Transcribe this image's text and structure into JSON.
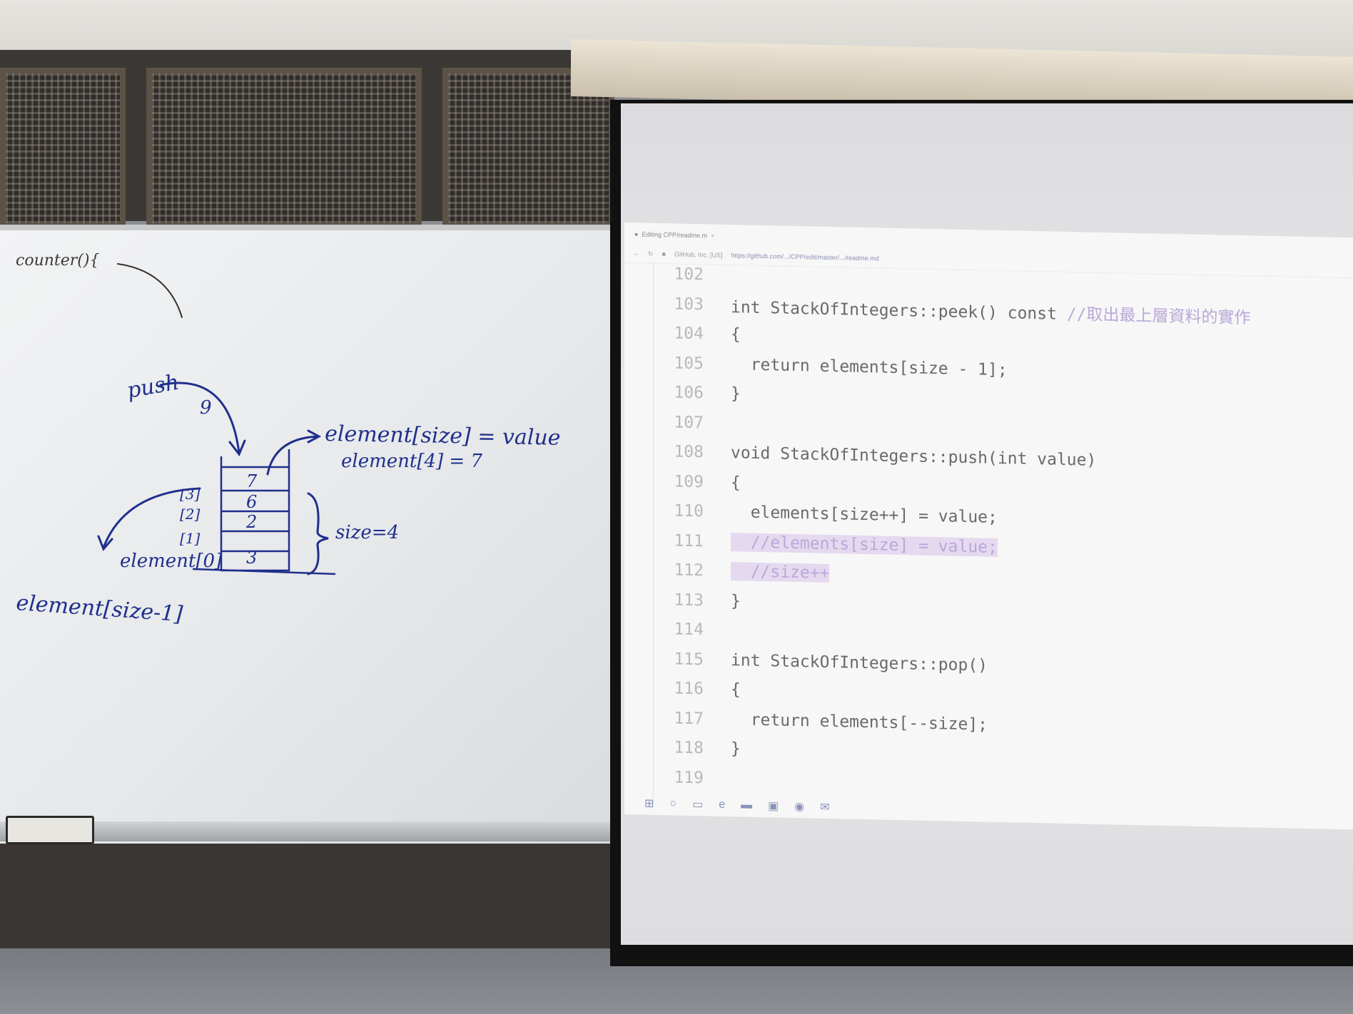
{
  "whiteboard": {
    "notes": {
      "counter": "counter(){",
      "push": "push",
      "pushed_value": "9",
      "assign_generic": "element[size] = value",
      "assign_example": "element[4] = 7",
      "size_note": "size=4",
      "top_formula": "element[size-1]",
      "base_label": "element[0]"
    },
    "stack": {
      "indices": [
        "[3]",
        "[2]",
        "[1]"
      ],
      "values": [
        "7",
        "6",
        "2",
        "3"
      ]
    }
  },
  "screen": {
    "tab_title": "Editing CPP/readme.m",
    "tab_close": "×",
    "address_prefix": "GitHub, Inc. [US]",
    "url": "https://github.com/.../CPP/edit/master/.../readme.md",
    "code_lines": [
      {
        "number": "102",
        "text": ""
      },
      {
        "number": "103",
        "text": "int StackOfIntegers::peek() const //取出最上層資料的實作"
      },
      {
        "number": "104",
        "text": "{"
      },
      {
        "number": "105",
        "text": "  return elements[size - 1];"
      },
      {
        "number": "106",
        "text": "}"
      },
      {
        "number": "107",
        "text": ""
      },
      {
        "number": "108",
        "text": "void StackOfIntegers::push(int value)"
      },
      {
        "number": "109",
        "text": "{"
      },
      {
        "number": "110",
        "text": "  elements[size++] = value;"
      },
      {
        "number": "111",
        "text": "  //elements[size] = value;",
        "highlighted": true
      },
      {
        "number": "112",
        "text": "  //size++",
        "highlighted": true
      },
      {
        "number": "113",
        "text": "}"
      },
      {
        "number": "114",
        "text": ""
      },
      {
        "number": "115",
        "text": "int StackOfIntegers::pop()"
      },
      {
        "number": "116",
        "text": "{"
      },
      {
        "number": "117",
        "text": "  return elements[--size];"
      },
      {
        "number": "118",
        "text": "}"
      },
      {
        "number": "119",
        "text": ""
      }
    ],
    "taskbar_icons": [
      "windows-icon",
      "search-icon",
      "task-view-icon",
      "edge-icon",
      "folder-icon",
      "store-icon",
      "chrome-icon",
      "mail-icon"
    ]
  },
  "colors": {
    "marker_ink": "#1f2f8c",
    "comment_highlight": "#e5d9f0",
    "comment_text": "#b9a8d8"
  }
}
